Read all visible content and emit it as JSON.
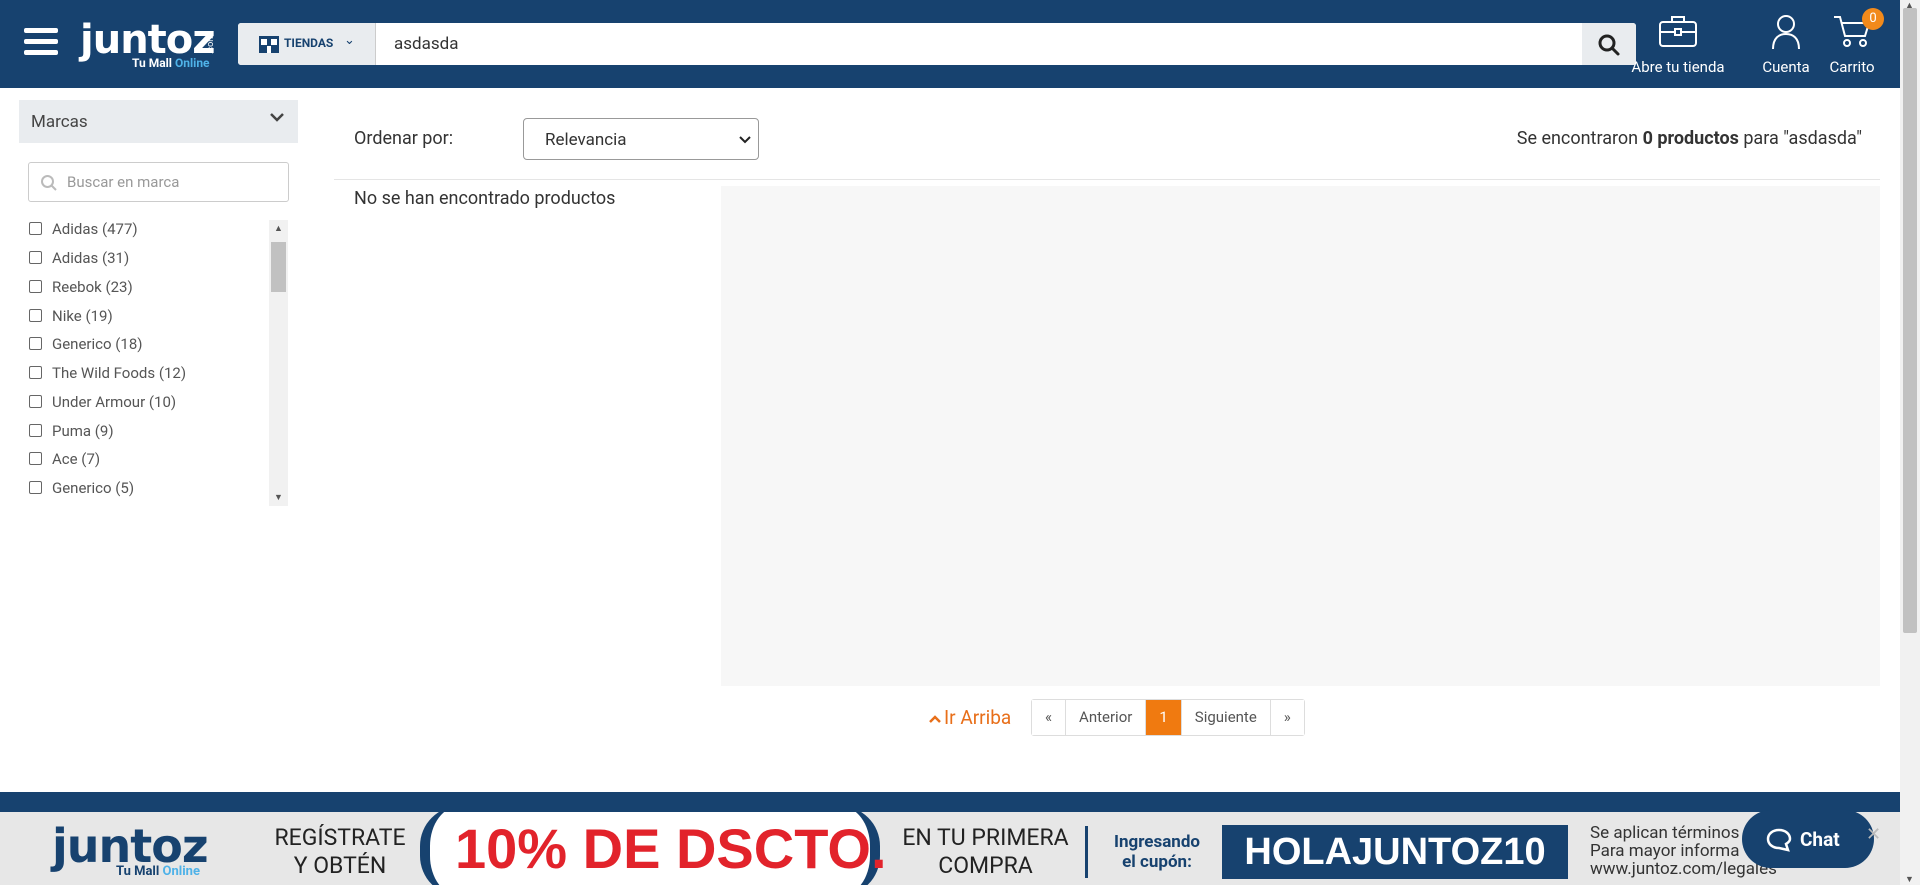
{
  "header": {
    "logo_text": "juntoz",
    "logo_com": ".com",
    "logo_tagline_1": "Tu Mall ",
    "logo_tagline_2": "Online",
    "stores_label": "TIENDAS",
    "search_value": "asdasda",
    "open_store_label": "Abre tu tienda",
    "account_label": "Cuenta",
    "cart_label": "Carrito",
    "cart_count": "0"
  },
  "sidebar": {
    "title": "Marcas",
    "search_placeholder": "Buscar en marca",
    "brands": [
      {
        "label": "Adidas (477)"
      },
      {
        "label": "Adidas (31)"
      },
      {
        "label": "Reebok (23)"
      },
      {
        "label": "Nike (19)"
      },
      {
        "label": "Generico (18)"
      },
      {
        "label": "The Wild Foods (12)"
      },
      {
        "label": "Under Armour (10)"
      },
      {
        "label": "Puma (9)"
      },
      {
        "label": "Ace (7)"
      },
      {
        "label": "Generico (5)"
      }
    ]
  },
  "main": {
    "sort_label": "Ordenar por:",
    "sort_value": "Relevancia",
    "result_prefix": "Se encontraron ",
    "result_count": "0 productos",
    "result_suffix": " para \"asdasda\"",
    "empty_message": "No se han encontrado productos"
  },
  "pagination": {
    "back_to_top": "Ir Arriba",
    "first": "«",
    "prev": "Anterior",
    "current": "1",
    "next": "Siguiente",
    "last": "»"
  },
  "banner": {
    "logo_text": "juntoz",
    "logo_tagline_1": "Tu Mall ",
    "logo_tagline_2": "Online",
    "register_line1": "REGÍSTRATE",
    "register_line2": "Y OBTÉN",
    "discount": "10% DE DSCTO.",
    "first_line1": "EN TU PRIMERA",
    "first_line2": "COMPRA",
    "coupon_line1": "Ingresando",
    "coupon_line2": "el cupón:",
    "coupon_code": "HOLAJUNTOZ10",
    "terms_line1": "Se aplican términos",
    "terms_line2": "Para mayor informa",
    "terms_line3": "www.juntoz.com/legales"
  },
  "chat": {
    "label": "Chat"
  },
  "colors": {
    "primary": "#17426f",
    "accent": "#f07a10",
    "brand_light": "#4fb2e8",
    "discount_red": "#e2232b"
  }
}
